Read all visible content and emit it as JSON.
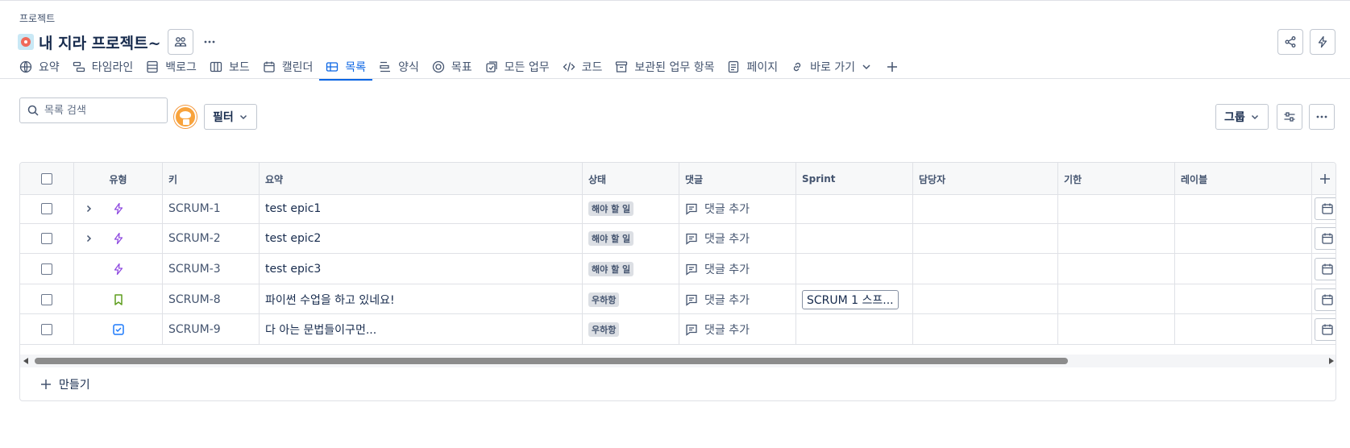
{
  "breadcrumb": "프로젝트",
  "project": {
    "title": "내 지라 프로젝트~"
  },
  "tabs": [
    {
      "label": "요약",
      "icon": "globe-icon"
    },
    {
      "label": "타임라인",
      "icon": "timeline-icon"
    },
    {
      "label": "백로그",
      "icon": "backlog-icon"
    },
    {
      "label": "보드",
      "icon": "board-icon"
    },
    {
      "label": "캘린더",
      "icon": "calendar-icon"
    },
    {
      "label": "목록",
      "icon": "list-icon",
      "active": true
    },
    {
      "label": "양식",
      "icon": "form-icon"
    },
    {
      "label": "목표",
      "icon": "goal-icon"
    },
    {
      "label": "모든 업무",
      "icon": "all-work-icon"
    },
    {
      "label": "코드",
      "icon": "code-icon"
    },
    {
      "label": "보관된 업무 항목",
      "icon": "archive-icon"
    },
    {
      "label": "페이지",
      "icon": "page-icon"
    },
    {
      "label": "바로 가기",
      "icon": "link-icon"
    }
  ],
  "toolbar": {
    "search_placeholder": "목록 검색",
    "filter_label": "필터",
    "group_label": "그룹"
  },
  "table": {
    "columns": [
      "유형",
      "키",
      "요약",
      "상태",
      "댓글",
      "Sprint",
      "담당자",
      "기한",
      "레이블"
    ],
    "rows": [
      {
        "expandable": true,
        "type": "epic",
        "key": "SCRUM-1",
        "summary": "test epic1",
        "status": "해야 할 일",
        "comment": "댓글 추가",
        "sprint": ""
      },
      {
        "expandable": true,
        "type": "epic",
        "key": "SCRUM-2",
        "summary": "test epic2",
        "status": "해야 할 일",
        "comment": "댓글 추가",
        "sprint": ""
      },
      {
        "expandable": false,
        "type": "epic",
        "key": "SCRUM-3",
        "summary": "test epic3",
        "status": "해야 할 일",
        "comment": "댓글 추가",
        "sprint": ""
      },
      {
        "expandable": false,
        "type": "story",
        "key": "SCRUM-8",
        "summary": "파이썬 수업을 하고 있네요!",
        "status": "우하항",
        "comment": "댓글 추가",
        "sprint": "SCRUM 1 스프..."
      },
      {
        "expandable": false,
        "type": "task",
        "key": "SCRUM-9",
        "summary": "다 아는 문법들이구먼...",
        "status": "우하항",
        "comment": "댓글 추가",
        "sprint": ""
      }
    ],
    "create_label": "만들기"
  },
  "colors": {
    "accent": "#0c66e4",
    "epic": "#8f4ae0",
    "story": "#5e9e1e",
    "task": "#1d7afc"
  }
}
